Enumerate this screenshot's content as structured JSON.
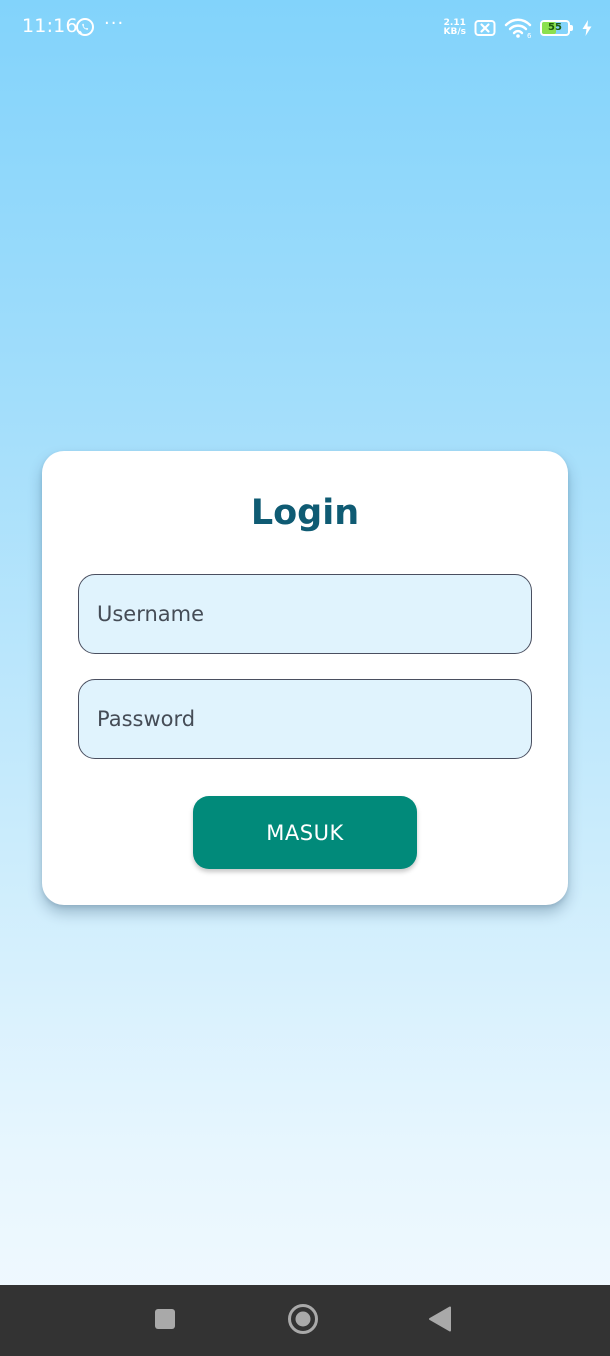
{
  "status_bar": {
    "time": "11:16",
    "dots": "···",
    "net_speed_value": "2.11",
    "net_speed_unit": "KB/s",
    "battery_level": "55",
    "battery_fraction": 0.55,
    "battery_color": "#8be04e",
    "icons": [
      "whatsapp-icon",
      "no-sim-icon",
      "wifi-icon",
      "battery-icon",
      "charging-bolt-icon"
    ]
  },
  "login": {
    "title": "Login",
    "username_placeholder": "Username",
    "password_placeholder": "Password",
    "submit_label": "MASUK"
  },
  "nav_bar": {
    "icons": [
      "recents-square-icon",
      "home-circle-icon",
      "back-triangle-icon"
    ]
  },
  "colors": {
    "title": "#0f5b73",
    "button": "#018a7a",
    "input_background": "#e0f3fd",
    "background_top": "#82d3fb",
    "background_bottom": "#f3faff",
    "nav_bar": "#333333"
  }
}
